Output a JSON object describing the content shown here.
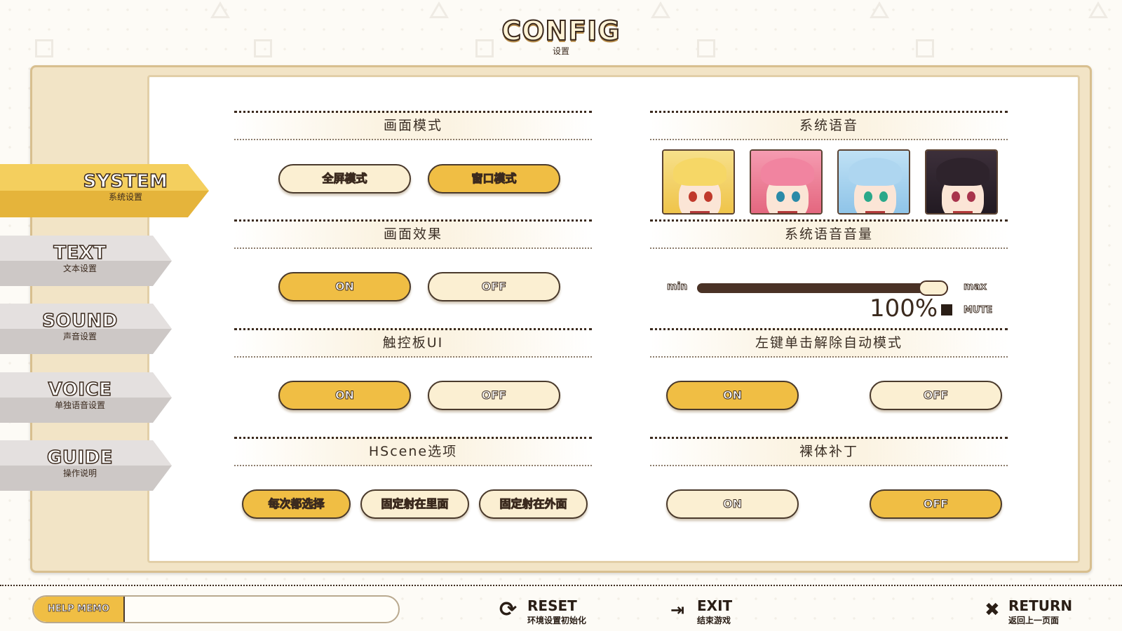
{
  "header": {
    "title": "CONFIG",
    "subtitle": "设置"
  },
  "sidebar": {
    "tabs": [
      {
        "en": "SYSTEM",
        "cn": "系统设置",
        "active": true
      },
      {
        "en": "TEXT",
        "cn": "文本设置",
        "active": false
      },
      {
        "en": "SOUND",
        "cn": "声音设置",
        "active": false
      },
      {
        "en": "VOICE",
        "cn": "单独语音设置",
        "active": false
      },
      {
        "en": "GUIDE",
        "cn": "操作说明",
        "active": false
      }
    ]
  },
  "left_sections": {
    "screen_mode": {
      "title": "画面模式",
      "options": [
        "全屏模式",
        "窗口模式"
      ],
      "selected": "窗口模式"
    },
    "screen_effect": {
      "title": "画面效果",
      "options": [
        "ON",
        "OFF"
      ],
      "selected": "ON"
    },
    "touchpad_ui": {
      "title": "触控板UI",
      "options": [
        "ON",
        "OFF"
      ],
      "selected": "ON"
    },
    "hscene": {
      "title": "HScene选项",
      "options": [
        "每次都选择",
        "固定射在里面",
        "固定射在外面"
      ],
      "selected": "每次都选择"
    }
  },
  "right_sections": {
    "system_voice": {
      "title": "系统语音",
      "characters": [
        "blonde-character",
        "pink-hair-character",
        "blue-hair-character",
        "black-hair-character"
      ]
    },
    "system_voice_volume": {
      "title": "系统语音音量",
      "min_label": "min",
      "max_label": "max",
      "percent_text": "100%",
      "value": 1.0,
      "mute_label": "MUTE"
    },
    "left_click_auto": {
      "title": "左键单击解除自动模式",
      "options": [
        "ON",
        "OFF"
      ],
      "selected": "ON"
    },
    "nude_patch": {
      "title": "裸体补丁",
      "options": [
        "ON",
        "OFF"
      ],
      "selected": "OFF"
    }
  },
  "bottom": {
    "help_memo_label": "HELP MEMO",
    "help_memo_text": "",
    "reset": {
      "en": "RESET",
      "cn": "环境设置初始化"
    },
    "exit": {
      "en": "EXIT",
      "cn": "结束游戏"
    },
    "return": {
      "en": "RETURN",
      "cn": "返回上一页面"
    }
  },
  "colors": {
    "accent": "#f0be44",
    "off": "#fbefd2",
    "frame": "#f2e4c6",
    "ink": "#3b2a1e"
  }
}
